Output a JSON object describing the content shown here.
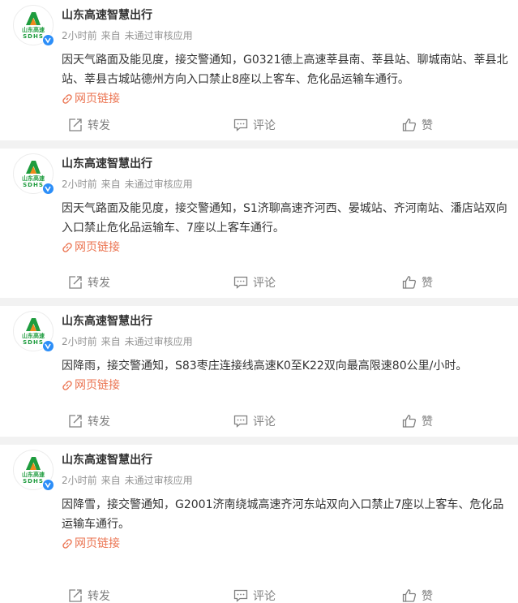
{
  "feed": {
    "weblink_label": "网页链接",
    "actions": {
      "repost": "转发",
      "comment": "评论",
      "like": "赞"
    },
    "posts": [
      {
        "author": "山东高速智慧出行",
        "time": "2小时前",
        "source_prefix": "来自",
        "source": "未通过审核应用",
        "text": "因天气路面及能见度，接交警通知，G0321德上高速莘县南、莘县站、聊城南站、莘县北站、莘县古城站德州方向入口禁止8座以上客车、危化品运输车通行。"
      },
      {
        "author": "山东高速智慧出行",
        "time": "2小时前",
        "source_prefix": "来自",
        "source": "未通过审核应用",
        "text": "因天气路面及能见度，接交警通知，S1济聊高速齐河西、晏城站、齐河南站、潘店站双向入口禁止危化品运输车、7座以上客车通行。"
      },
      {
        "author": "山东高速智慧出行",
        "time": "2小时前",
        "source_prefix": "来自",
        "source": "未通过审核应用",
        "text": "因降雨，接交警通知，S83枣庄连接线高速K0至K22双向最高限速80公里/小时。"
      },
      {
        "author": "山东高速智慧出行",
        "time": "2小时前",
        "source_prefix": "来自",
        "source": "未通过审核应用",
        "text": "因降雪，接交警通知，G2001济南绕城高速齐河东站双向入口禁止7座以上客车、危化品运输车通行。"
      }
    ]
  },
  "avatar_logo": {
    "text": "山东高速",
    "sub": "SDHS"
  },
  "colors": {
    "link": "#eb7350",
    "verified": "#2c8ef8",
    "logo_green": "#1e9c3e",
    "logo_orange": "#f08a1c",
    "meta": "#939393"
  }
}
